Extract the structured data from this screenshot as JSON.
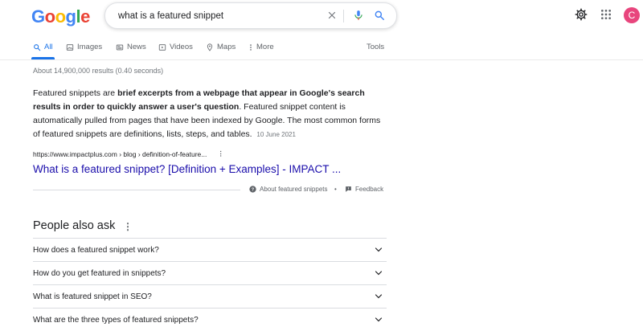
{
  "header": {
    "logo_letters": [
      {
        "char": "G",
        "color": "#4285f4"
      },
      {
        "char": "o",
        "color": "#ea4335"
      },
      {
        "char": "o",
        "color": "#fbbc05"
      },
      {
        "char": "g",
        "color": "#4285f4"
      },
      {
        "char": "l",
        "color": "#34a853"
      },
      {
        "char": "e",
        "color": "#ea4335"
      }
    ],
    "search_query": "what is a featured snippet",
    "avatar_letter": "C",
    "icons": [
      "clear-icon",
      "microphone-icon",
      "search-icon",
      "settings-gear-icon",
      "apps-grid-icon"
    ]
  },
  "tabs": {
    "items": [
      {
        "label": "All",
        "icon": "search-icon",
        "active": true
      },
      {
        "label": "Images",
        "icon": "image-icon"
      },
      {
        "label": "News",
        "icon": "news-icon"
      },
      {
        "label": "Videos",
        "icon": "play-icon"
      },
      {
        "label": "Maps",
        "icon": "map-pin-icon"
      },
      {
        "label": "More",
        "icon": "more-vert-icon"
      }
    ],
    "tools_label": "Tools"
  },
  "results_stats": "About 14,900,000 results (0.40 seconds)",
  "featured_snippet": {
    "text_before": "Featured snippets are ",
    "text_bold": "brief excerpts from a webpage that appear in Google's search results in order to quickly answer a user's question",
    "text_after": ". Featured snippet content is automatically pulled from pages that have been indexed by Google. The most common forms of featured snippets are definitions, lists, steps, and tables.",
    "date": "10 June 2021",
    "url": "https://www.impactplus.com › blog › definition-of-feature...",
    "title": "What is a featured snippet? [Definition + Examples] - IMPACT ...",
    "about_label": "About featured snippets",
    "feedback_label": "Feedback",
    "separator": "•"
  },
  "people_also_ask": {
    "title": "People also ask",
    "questions": [
      "How does a featured snippet work?",
      "How do you get featured in snippets?",
      "What is featured snippet in SEO?",
      "What are the three types of featured snippets?"
    ]
  },
  "colors": {
    "accent": "#1a73e8",
    "link": "#1a0dab",
    "avatar": "#e8457d"
  }
}
